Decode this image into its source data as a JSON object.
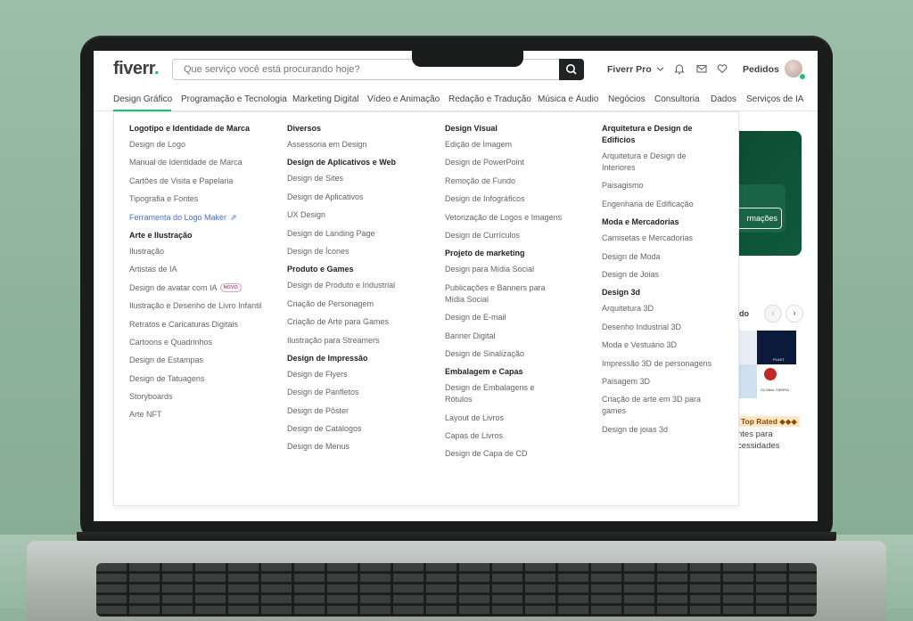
{
  "header": {
    "logo_text": "fiverr",
    "logo_dot": ".",
    "search_placeholder": "Que serviço você está procurando hoje?",
    "fiverr_pro": "Fiverr Pro",
    "orders": "Pedidos",
    "icons": [
      "search-icon",
      "bell-icon",
      "mail-icon",
      "heart-icon",
      "chevron-down-icon"
    ]
  },
  "categories": [
    "Design Gráfico",
    "Programação e Tecnologia",
    "Marketing Digital",
    "Vídeo e Animação",
    "Redação e Tradução",
    "Música e Áudio",
    "Negócios",
    "Consultoria",
    "Dados",
    "Serviços de IA"
  ],
  "menu": {
    "col1": [
      {
        "title": "Logotipo e Identidade de Marca",
        "links": [
          "Design de Logo",
          "Manual de Identidade de Marca",
          "Cartões de Visita e Papelaria",
          "Tipografia e Fontes",
          "Ferramenta do Logo Maker"
        ]
      },
      {
        "title": "Arte e Ilustração",
        "links": [
          "Ilustração",
          "Artistas de IA",
          "Design de avatar com IA",
          "Ilustração e Desenho de Livro Infantil",
          "Retratos e Caricaturas Digitais",
          "Cartoons e Quadrinhos",
          "Design de Estampas",
          "Design de Tatuagens",
          "Storyboards",
          "Arte NFT"
        ]
      }
    ],
    "col2": [
      {
        "title": "Diversos",
        "links": [
          "Assessoria em Design"
        ]
      },
      {
        "title": "Design de Aplicativos e Web",
        "links": [
          "Design de Sites",
          "Design de Aplicativos",
          "UX Design",
          "Design de Landing Page",
          "Design de Ícones"
        ]
      },
      {
        "title": "Produto e Games",
        "links": [
          "Design de Produto e Industrial",
          "Criação de Personagem",
          "Criação de Arte para Games",
          "Ilustração para Streamers"
        ]
      },
      {
        "title": "Design de Impressão",
        "links": [
          "Design de Flyers",
          "Design de Panfletos",
          "Design de Pôster",
          "Design de Catálogos",
          "Design de Menus"
        ]
      }
    ],
    "col3": [
      {
        "title": "Design Visual",
        "links": [
          "Edição de Imagem",
          "Design de PowerPoint",
          "Remoção de Fundo",
          "Design de Infográficos",
          "Vetorização de Logos e Imagens",
          "Design de Currículos"
        ]
      },
      {
        "title": "Projeto de marketing",
        "links": [
          "Design para Mídia Social",
          "Publicações e Banners para Mídia Social",
          "Design de E-mail",
          "Banner Digital",
          "Design de Sinalização"
        ]
      },
      {
        "title": "Embalagem e Capas",
        "links": [
          "Design de Embalagens e Rótulos",
          "Layout de Livros",
          "Capas de Livros",
          "Design de Capa de CD"
        ]
      }
    ],
    "col4": [
      {
        "title": "Arquitetura e Design de Edifícios",
        "links": [
          "Arquitetura e Design de Interiores",
          "Paisagismo",
          "Engenharia de Edificação"
        ]
      },
      {
        "title": "Moda e Mercadorias",
        "links": [
          "Camisetas e Mercadorias",
          "Design de Moda",
          "Design de Joias"
        ]
      },
      {
        "title": "Design 3d",
        "links": [
          "Arquitetura 3D",
          "Desenho Industrial 3D",
          "Moda e Vestuário 3D",
          "Impressão 3D de personagens",
          "Paisagem 3D",
          "Criação de arte em 3D para games",
          "Design de joias 3d"
        ]
      }
    ],
    "new_badge": "NOVO"
  },
  "background_page": {
    "hero_button": "rmações",
    "section_label": "do",
    "top_rated": "Top Rated ◆◆◆",
    "desc": "ntes para cessidades",
    "thumb_text_1": "PLAST",
    "thumb_text_2": "GLOBAL SIERRA"
  },
  "colors": {
    "brand_green": "#1dbf73",
    "accent_link": "#446ee7",
    "text_dark": "#404145",
    "text_muted": "#62646a"
  }
}
